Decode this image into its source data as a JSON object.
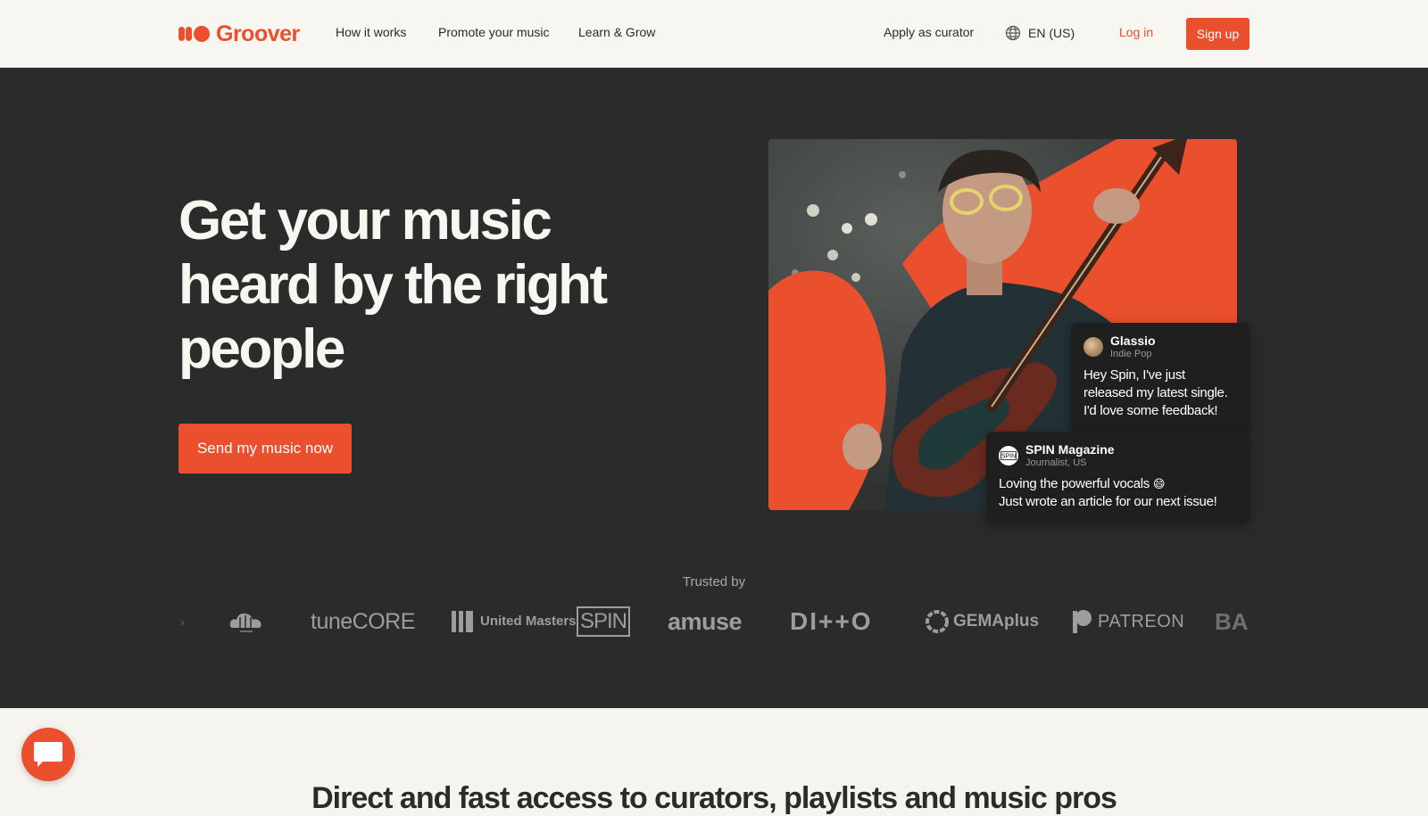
{
  "brand": {
    "name": "Groover",
    "accent": "#ea4f2e",
    "dark": "#2b2b2b"
  },
  "nav": {
    "links": [
      "How it works",
      "Promote your music",
      "Learn & Grow"
    ],
    "apply": "Apply as curator",
    "language": "EN (US)",
    "login": "Log in",
    "signup": "Sign up"
  },
  "hero": {
    "headline": "Get your music heard by the right people",
    "cta": "Send my music now",
    "chat1": {
      "name": "Glassio",
      "subtitle": "Indie Pop",
      "message": "Hey Spin, I've just released my latest single. I'd love some feedback!"
    },
    "chat2": {
      "name": "SPIN Magazine",
      "subtitle": "Journalist, US",
      "message_line1": "Loving the powerful vocals",
      "emoji": "😄",
      "message_line2": "Just wrote an article for our next issue!"
    },
    "trusted_label": "Trusted by",
    "partners": [
      "tuneCORE",
      "United Masters",
      "SPIN",
      "amuse",
      "DI++O",
      "GEMAplus",
      "PATREON",
      "BAN"
    ]
  },
  "section": {
    "title": "Direct and fast access to curators, playlists and music pros"
  },
  "icons": {
    "globe": "globe-icon",
    "chat": "chat-icon"
  }
}
